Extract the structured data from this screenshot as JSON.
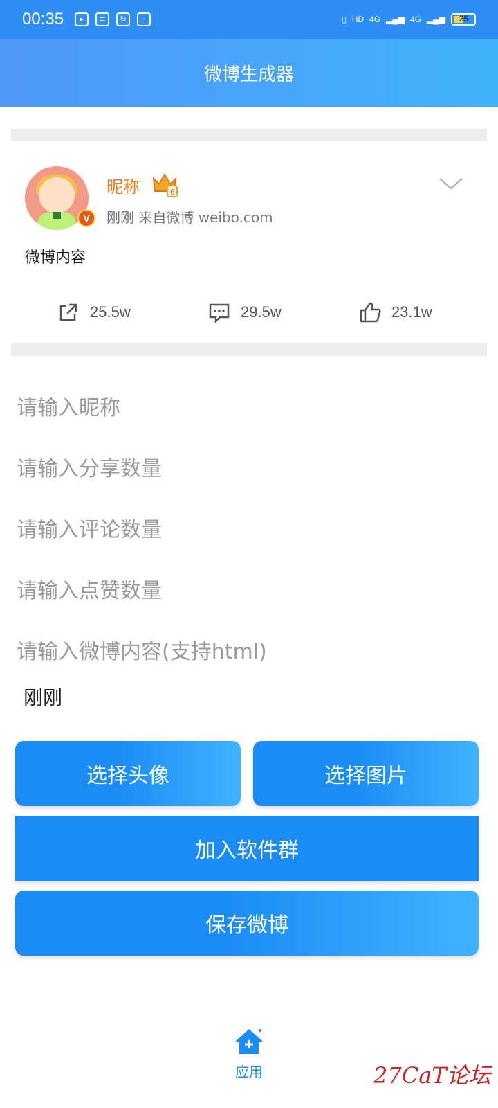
{
  "status_bar": {
    "time": "00:35",
    "hd_label": "HD",
    "net_label_1": "4G",
    "net_label_2": "4G",
    "battery_level": "35"
  },
  "title": "微博生成器",
  "post": {
    "nickname": "昵称",
    "meta": "刚刚  来自微博 weibo.com",
    "content": "微博内容",
    "share_count": "25.5w",
    "comment_count": "29.5w",
    "like_count": "23.1w"
  },
  "inputs": {
    "nickname_placeholder": "请输入昵称",
    "share_placeholder": "请输入分享数量",
    "comment_placeholder": "请输入评论数量",
    "like_placeholder": "请输入点赞数量",
    "content_placeholder": "请输入微博内容(支持html)",
    "time_value": "刚刚"
  },
  "buttons": {
    "choose_avatar": "选择头像",
    "choose_image": "选择图片",
    "join_group": "加入软件群",
    "save_post": "保存微博"
  },
  "nav": {
    "apps_label": "应用"
  },
  "watermark": "27CaT论坛",
  "colors": {
    "primary": "#1b8cf5",
    "header_gradient_start": "#4f97f8",
    "header_gradient_end": "#40b2fb",
    "nickname": "#f27a1a"
  }
}
